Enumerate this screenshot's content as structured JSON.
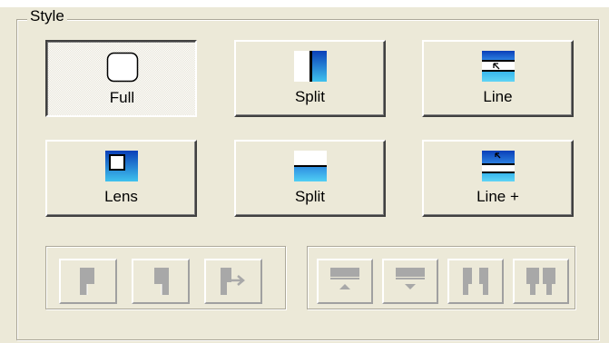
{
  "group": {
    "legend": "Style"
  },
  "style_buttons": [
    {
      "label": "Full",
      "icon": "rounded-frame-icon",
      "pressed": true
    },
    {
      "label": "Split",
      "icon": "split-vertical-icon",
      "pressed": false
    },
    {
      "label": "Line",
      "icon": "line-cursor-icon",
      "pressed": false
    },
    {
      "label": "Lens",
      "icon": "lens-icon",
      "pressed": false
    },
    {
      "label": "Split",
      "icon": "split-horizontal-icon",
      "pressed": false
    },
    {
      "label": "Line +",
      "icon": "line-plus-cursor-icon",
      "pressed": false
    }
  ],
  "disabled_controls": {
    "left_group": [
      "align-left-flag-icon",
      "align-right-flag-icon",
      "move-right-flag-icon"
    ],
    "right_group": [
      "align-top-up-icon",
      "align-bottom-down-icon",
      "split-columns-icon",
      "join-columns-icon"
    ]
  },
  "colors": {
    "panel_bg": "#ece9d8",
    "accent_blue_dark": "#0a3fb8",
    "accent_blue_light": "#3fc2ee",
    "disabled_gray": "#a0a0a0",
    "heading_blue": "#1f2fa0"
  }
}
